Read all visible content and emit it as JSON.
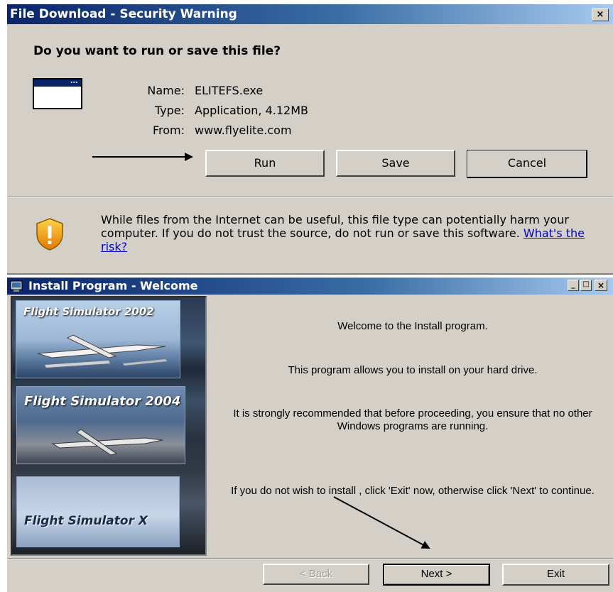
{
  "download_dialog": {
    "title": "File Download - Security Warning",
    "close_glyph": "×",
    "question": "Do you want to run or save this file?",
    "file_icon": "application-window-icon",
    "info": [
      {
        "label": "Name:",
        "value": "ELITEFS.exe"
      },
      {
        "label": "Type:",
        "value": "Application, 4.12MB"
      },
      {
        "label": "From:",
        "value": "www.flyelite.com"
      }
    ],
    "buttons": {
      "run": "Run",
      "save": "Save",
      "cancel": "Cancel"
    },
    "warning_icon": "security-shield-icon",
    "warning_text": "While files from the Internet can be useful, this file type can potentially harm your computer. If you do not trust the source, do not run or save this software.",
    "risk_link": "What's the risk?"
  },
  "install_dialog": {
    "title": "Install Program - Welcome",
    "title_icon": "installer-icon",
    "window_controls": {
      "minimize": "_",
      "maximize": "□",
      "close": "×"
    },
    "images": [
      {
        "title": "Flight Simulator 2002"
      },
      {
        "title": "Flight Simulator 2004"
      },
      {
        "title": "Flight Simulator X"
      }
    ],
    "welcome": "Welcome to the  Install program.",
    "allows": "This program allows you to install  on your hard drive.",
    "recommend": "It is strongly recommended that before proceeding, you ensure that no other Windows programs are running.",
    "exit_note": "If you do not wish to install , click 'Exit' now, otherwise click 'Next' to continue.",
    "buttons": {
      "back": "< Back",
      "next": "Next >",
      "exit": "Exit"
    },
    "back_enabled": false
  },
  "annotations": {
    "arrows": [
      "arrow-to-run-button",
      "arrow-to-next-button"
    ],
    "color": "#000000"
  }
}
